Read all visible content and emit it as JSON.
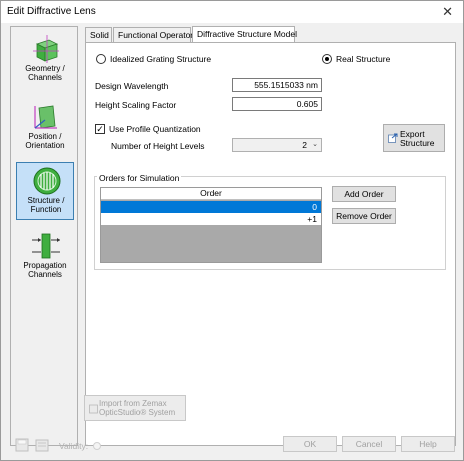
{
  "window": {
    "title": "Edit Diffractive Lens",
    "close_glyph": "✕"
  },
  "sidebar": {
    "items": [
      {
        "label": "Geometry /\nChannels",
        "icon": "geometry-cube-icon",
        "active": false
      },
      {
        "label": "Position /\nOrientation",
        "icon": "position-axes-icon",
        "active": false
      },
      {
        "label": "Structure /\nFunction",
        "icon": "structure-grating-icon",
        "active": true
      },
      {
        "label": "Propagation\nChannels",
        "icon": "propagation-channels-icon",
        "active": false
      }
    ]
  },
  "tabs": [
    {
      "label": "Solid"
    },
    {
      "label": "Functional Operator"
    },
    {
      "label": "Diffractive Structure Model"
    }
  ],
  "structure": {
    "idealized_label": "Idealized Grating Structure",
    "real_label": "Real Structure",
    "selected": "real"
  },
  "fields": {
    "wavelength_label": "Design Wavelength",
    "wavelength_value": "555.1515033 nm",
    "height_label": "Height Scaling Factor",
    "height_value": "0.605",
    "quantization_label": "Use Profile Quantization",
    "quantization_checked": true,
    "levels_label": "Number of Height Levels",
    "levels_value": "2"
  },
  "export_button": {
    "line1": "Export",
    "line2": "Structure"
  },
  "orders": {
    "group_label": "Orders for Simulation",
    "column_header": "Order",
    "rows": [
      "0",
      "+1"
    ],
    "selected_index": 0,
    "add_label": "Add Order",
    "remove_label": "Remove Order"
  },
  "import_button": {
    "line1": "Import from Zemax",
    "line2": "OpticStudio® System"
  },
  "footer": {
    "validity_label": "Validity:",
    "ok_label": "OK",
    "cancel_label": "Cancel",
    "help_label": "Help"
  },
  "colors": {
    "accent": "#0078d7",
    "active_nav": "#c5e0f8"
  }
}
